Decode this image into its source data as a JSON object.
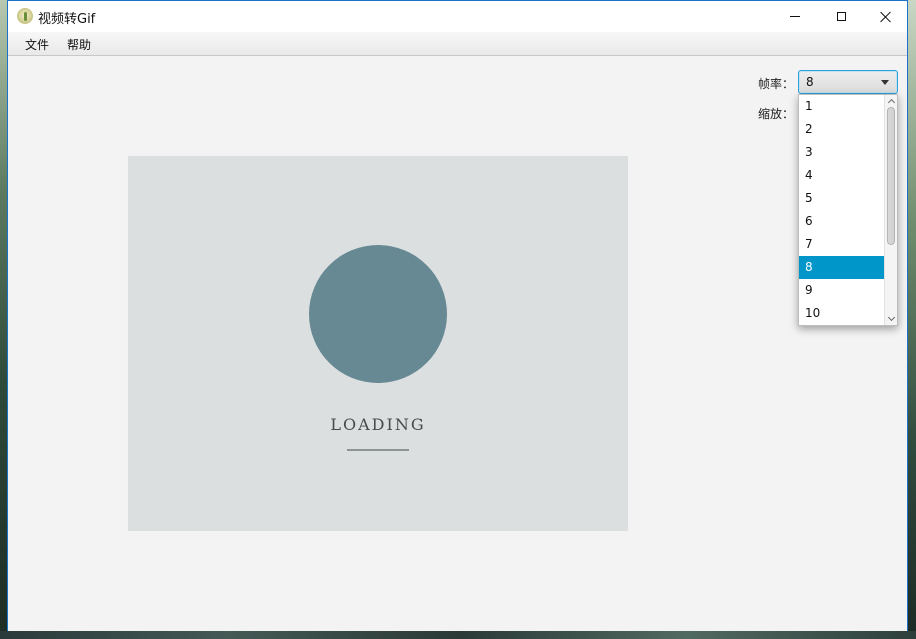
{
  "window": {
    "title": "视频转Gif",
    "accent_color": "#1a73c7"
  },
  "menu": {
    "file": "文件",
    "help": "帮助"
  },
  "preview": {
    "loading_text": "LOADING",
    "circle_color": "#668994"
  },
  "settings": {
    "fps_label": "帧率：",
    "scale_label": "缩放：",
    "fps_selected": "8",
    "fps_options": [
      "1",
      "2",
      "3",
      "4",
      "5",
      "6",
      "7",
      "8",
      "9",
      "10"
    ],
    "selection_color": "#0096c9"
  },
  "icons": {
    "app": "video-app-icon",
    "minimize": "minimize-icon",
    "maximize": "maximize-icon",
    "close": "close-icon",
    "dropdown": "chevron-down-icon"
  }
}
